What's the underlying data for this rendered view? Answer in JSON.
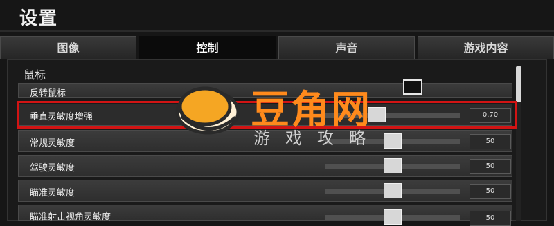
{
  "title": "设置",
  "tabs": [
    {
      "label": "图像",
      "active": false
    },
    {
      "label": "控制",
      "active": true
    },
    {
      "label": "声音",
      "active": false
    },
    {
      "label": "游戏内容",
      "active": false
    }
  ],
  "section_title": "鼠标",
  "settings": [
    {
      "label": "反转鼠标",
      "type": "checkbox",
      "checked": false
    },
    {
      "label": "垂直灵敏度增强",
      "type": "slider",
      "value": "0.70",
      "position": 0.38
    },
    {
      "label": "常规灵敏度",
      "type": "slider",
      "value": "50",
      "position": 0.5
    },
    {
      "label": "驾驶灵敏度",
      "type": "slider",
      "value": "50",
      "position": 0.5
    },
    {
      "label": "瞄准灵敏度",
      "type": "slider",
      "value": "50",
      "position": 0.5
    },
    {
      "label": "瞄准射击视角灵敏度",
      "type": "slider",
      "value": "50",
      "position": 0.5
    }
  ],
  "watermark": {
    "brand": "豆角网",
    "subtitle": "游戏攻略",
    "colors": {
      "egg": "#f5a623",
      "brand": "#ff8a1c"
    }
  },
  "colors": {
    "highlight_frame": "#d21414"
  }
}
